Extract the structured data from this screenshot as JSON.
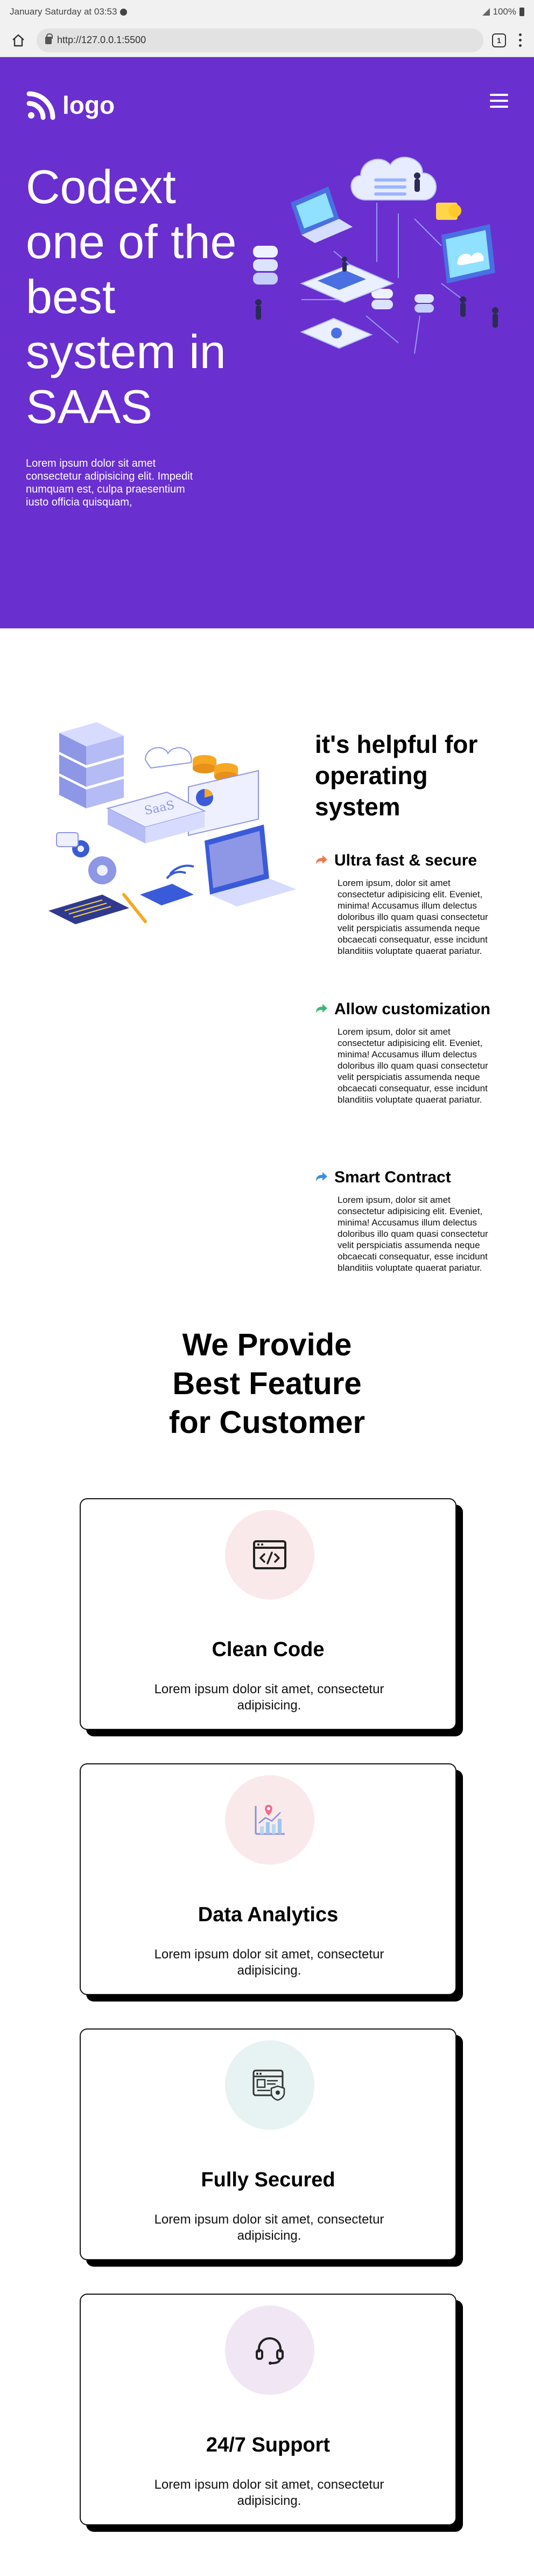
{
  "status_bar": {
    "time_text": "January Saturday at 03:53",
    "battery_text": "100%"
  },
  "browser": {
    "url": "http://127.0.0.1:5500",
    "tab_count": "1"
  },
  "hero": {
    "logo_text": "logo",
    "title": "Codext one of the best system in SAAS",
    "description": "Lorem ipsum dolor sit amet consectetur adipisicing elit. Impedit numquam est, culpa praesentium iusto officia quisquam,"
  },
  "helpful": {
    "title": "it's helpful for operating system",
    "features": [
      {
        "title": "Ultra fast & secure",
        "body": "Lorem ipsum, dolor sit amet consectetur adipisicing elit. Eveniet, minima! Accusamus illum delectus doloribus illo quam quasi consectetur velit perspiciatis assumenda neque obcaecati consequatur, esse incidunt blanditiis voluptate quaerat pariatur.",
        "arrow_color": "#f2784b"
      },
      {
        "title": "Allow customization",
        "body": "Lorem ipsum, dolor sit amet consectetur adipisicing elit. Eveniet, minima! Accusamus illum delectus doloribus illo quam quasi consectetur velit perspiciatis assumenda neque obcaecati consequatur, esse incidunt blanditiis voluptate quaerat pariatur.",
        "arrow_color": "#3cb878"
      },
      {
        "title": "Smart Contract",
        "body": "Lorem ipsum, dolor sit amet consectetur adipisicing elit. Eveniet, minima! Accusamus illum delectus doloribus illo quam quasi consectetur velit perspiciatis assumenda neque obcaecati consequatur, esse incidunt blanditiis voluptate quaerat pariatur.",
        "arrow_color": "#3a8ee6"
      }
    ]
  },
  "features_section": {
    "title": "We Provide Best Feature for Customer",
    "cards": [
      {
        "title": "Clean Code",
        "text": "Lorem ipsum dolor sit amet, consectetur adipisicing.",
        "icon": "code-window-icon",
        "icon_bg": "#fae9ea"
      },
      {
        "title": "Data Analytics",
        "text": "Lorem ipsum dolor sit amet, consectetur adipisicing.",
        "icon": "analytics-chart-icon",
        "icon_bg": "#fae9ea"
      },
      {
        "title": "Fully Secured",
        "text": "Lorem ipsum dolor sit amet, consectetur adipisicing.",
        "icon": "secure-browser-icon",
        "icon_bg": "#e7f2f2"
      },
      {
        "title": "24/7 Support",
        "text": "Lorem ipsum dolor sit amet, consectetur adipisicing.",
        "icon": "headset-icon",
        "icon_bg": "#f1e6f3"
      }
    ]
  },
  "colors": {
    "hero_bg": "#6a2fcf",
    "accent": "#6a2fcf"
  }
}
